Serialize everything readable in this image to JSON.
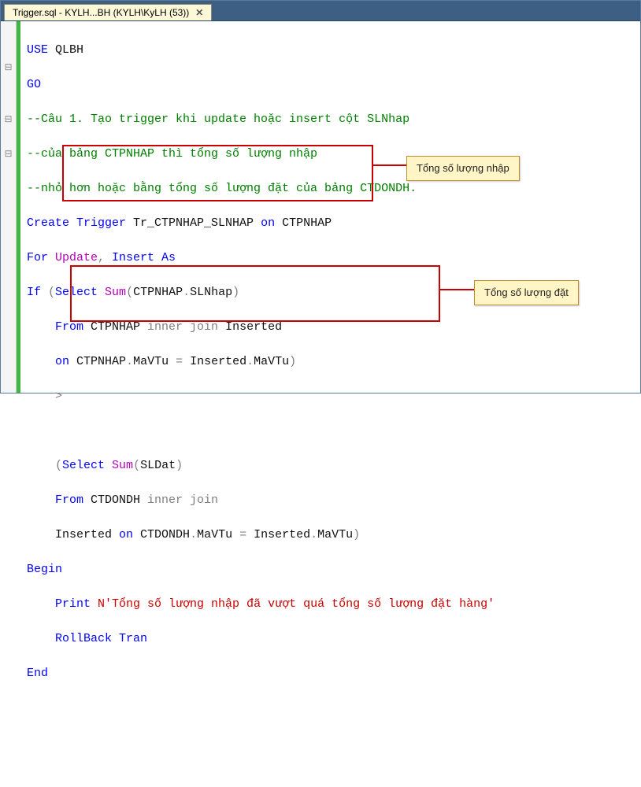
{
  "tab": {
    "title": "Trigger.sql - KYLH...BH (KYLH\\KyLH (53))",
    "close": "✕"
  },
  "code": {
    "l1_kw": "USE",
    "l1_id": " QLBH",
    "l2_kw": "GO",
    "l3": "--Câu 1. Tạo trigger khi update hoặc insert cột SLNhap",
    "l4": "--của bảng CTPNHAP thì tổng số lượng nhập",
    "l5": "--nhỏ hơn hoặc bằng tổng số lượng đặt của bảng CTDONDH.",
    "l6a": "Create Trigger",
    "l6b": " Tr_CTPNHAP_SLNHAP ",
    "l6c": "on",
    "l6d": " CTPNHAP",
    "l7a": "For",
    "l7b": " Update",
    "l7c": ",",
    "l7d": " Insert As",
    "l8a": "If ",
    "l8b": "(",
    "l8c": "Select ",
    "l8d": "Sum",
    "l8e": "(",
    "l8f": "CTPNHAP",
    "l8g": ".",
    "l8h": "SLNhap",
    "l8i": ")",
    "l9a": "    ",
    "l9b": "From",
    "l9c": " CTPNHAP ",
    "l9d": "inner join",
    "l9e": " Inserted",
    "l10a": "    ",
    "l10b": "on",
    "l10c": " CTPNHAP",
    "l10d": ".",
    "l10e": "MaVTu ",
    "l10f": "=",
    "l10g": " Inserted",
    "l10h": ".",
    "l10i": "MaVTu",
    "l10j": ")",
    "l11": "    >",
    "l12a": "    ",
    "l12b": "(",
    "l12c": "Select ",
    "l12d": "Sum",
    "l12e": "(",
    "l12f": "SLDat",
    "l12g": ")",
    "l13a": "    ",
    "l13b": "From",
    "l13c": " CTDONDH ",
    "l13d": "inner join",
    "l14a": "    Inserted ",
    "l14b": "on",
    "l14c": " CTDONDH",
    "l14d": ".",
    "l14e": "MaVTu ",
    "l14f": "=",
    "l14g": " Inserted",
    "l14h": ".",
    "l14i": "MaVTu",
    "l14j": ")",
    "l15": "Begin",
    "l16a": "    ",
    "l16b": "Print ",
    "l16c": "N'Tổng số lượng nhập đã vượt quá tổng số lượng đặt hàng'",
    "l17a": "    ",
    "l17b": "RollBack Tran",
    "l18": "End"
  },
  "callouts": {
    "c1": "Tổng số lượng nhập",
    "c2": "Tổng số lượng đặt"
  },
  "outline": {
    "m1": "⊟",
    "m2": "⊟",
    "m3": "⊟"
  }
}
